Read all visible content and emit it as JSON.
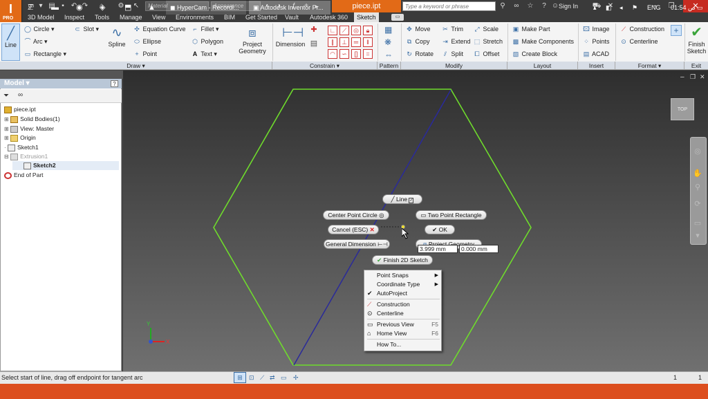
{
  "titlebar": {
    "material_placeholder": "Material",
    "appearance_placeholder": "Appearance",
    "document_title": "piece.ipt",
    "search_placeholder": "Type a keyword or phrase",
    "sign_in": "Sign In"
  },
  "menu": [
    "3D Model",
    "Inspect",
    "Tools",
    "Manage",
    "View",
    "Environments",
    "BIM",
    "Get Started",
    "Vault",
    "Autodesk 360",
    "Sketch"
  ],
  "ribbon": {
    "line": "Line",
    "circle": "Circle",
    "arc": "Arc",
    "rectangle": "Rectangle",
    "slot": "Slot",
    "spline": "Spline",
    "equation_curve": "Equation Curve",
    "ellipse": "Ellipse",
    "point": "Point",
    "fillet": "Fillet",
    "polygon": "Polygon",
    "text": "Text",
    "project_geometry_1": "Project",
    "project_geometry_2": "Geometry",
    "dimension": "Dimension",
    "move": "Move",
    "copy": "Copy",
    "rotate": "Rotate",
    "trim": "Trim",
    "extend": "Extend",
    "split": "Split",
    "scale": "Scale",
    "stretch": "Stretch",
    "offset": "Offset",
    "make_part": "Make Part",
    "make_components": "Make Components",
    "create_block": "Create Block",
    "image": "Image",
    "points": "Points",
    "acad": "ACAD",
    "construction": "Construction",
    "centerline": "Centerline",
    "finish_sketch_1": "Finish",
    "finish_sketch_2": "Sketch"
  },
  "groups": {
    "draw": "Draw",
    "constrain": "Constrain",
    "pattern": "Pattern",
    "modify": "Modify",
    "layout": "Layout",
    "insert": "Insert",
    "format": "Format",
    "exit": "Exit"
  },
  "panel": {
    "title": "Model",
    "help": "?",
    "tree": [
      {
        "label": "piece.ipt"
      },
      {
        "label": "Solid Bodies(1)"
      },
      {
        "label": "View: Master"
      },
      {
        "label": "Origin"
      },
      {
        "label": "Sketch1"
      },
      {
        "label": "Extrusion1"
      },
      {
        "label": "Sketch2"
      },
      {
        "label": "End of Part"
      }
    ]
  },
  "viewcube": {
    "label": "TOP"
  },
  "minitoolbar": {
    "line": "Line",
    "center_point_circle": "Center Point Circle",
    "two_point_rectangle": "Two Point Rectangle",
    "cancel": "Cancel (ESC)",
    "ok": "OK",
    "general_dimension": "General Dimension",
    "project_geometry": "Project Geometry",
    "finish_2d_sketch": "Finish 2D Sketch"
  },
  "input": {
    "length": "3.999 mm",
    "angle": "0.000 mm"
  },
  "context_menu": [
    {
      "label": "Point Snaps",
      "shortcut": ""
    },
    {
      "label": "Coordinate Type",
      "shortcut": ""
    },
    {
      "label": "AutoProject",
      "shortcut": ""
    },
    {
      "label": "Construction",
      "shortcut": ""
    },
    {
      "label": "Centerline",
      "shortcut": ""
    },
    {
      "label": "Previous View",
      "shortcut": "F5"
    },
    {
      "label": "Home View",
      "shortcut": "F6"
    },
    {
      "label": "How To...",
      "shortcut": ""
    }
  ],
  "axis": {
    "x": "X",
    "y": "Y"
  },
  "status": {
    "message": "Select start of line, drag off endpoint for tangent arc",
    "page_a": "1",
    "page_b": "1"
  },
  "taskbar": {
    "hypercam": "HyperCam - Recordi...",
    "inventor": "Autodesk Inventor Pr...",
    "lang": "ENG",
    "time": "01:54 ص"
  }
}
